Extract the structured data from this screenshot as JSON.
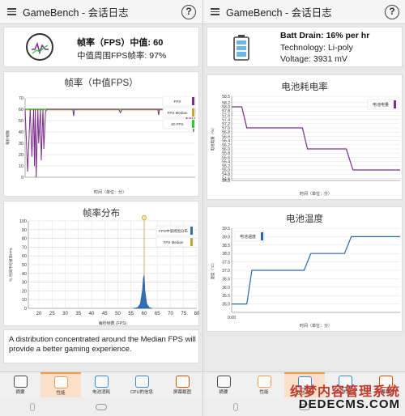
{
  "app": {
    "title": "GameBench - 会话日志",
    "help": "?"
  },
  "left": {
    "summary": {
      "main": "帧率（FPS）中值: 60",
      "sub": "中值周围FPS帧率: 97%"
    },
    "note": "A distribution concentrated around the Median FPS will provide a better gaming experience.",
    "nav": [
      {
        "label": "摘要",
        "icon": "list-icon"
      },
      {
        "label": "性能",
        "icon": "performance-icon"
      },
      {
        "label": "电池消耗",
        "icon": "battery-icon"
      },
      {
        "label": "CPU的信息",
        "icon": "cpu-icon"
      },
      {
        "label": "屏幕截图",
        "icon": "screenshot-icon"
      }
    ]
  },
  "right": {
    "summary": {
      "main": "Batt Drain: 16% per hr",
      "tech": "Technology: Li-poly",
      "voltage": "Voltage: 3931 mV"
    },
    "nav": [
      {
        "label": "摘要",
        "icon": "list-icon"
      },
      {
        "label": "性能",
        "icon": "performance-icon"
      },
      {
        "label": "电池消耗",
        "icon": "battery-icon"
      },
      {
        "label": "CPU的信息",
        "icon": "cpu-icon"
      },
      {
        "label": "屏幕截图",
        "icon": "screenshot-icon"
      }
    ]
  },
  "colors": {
    "fps": "#7a2d8a",
    "median": "#c9a23a",
    "sixty": "#2ecc2e",
    "battery": "#7a2d8a",
    "temp": "#2a67b0",
    "accent": "#f29a4d"
  },
  "watermark": {
    "line1": "织梦内容管理系统",
    "line2": "DEDECMS.COM"
  },
  "chart_data": [
    {
      "type": "line",
      "title": "帧率（中值FPS）",
      "xlabel": "时间（单位：分）",
      "ylabel": "每秒帧数",
      "ylim": [
        0,
        70
      ],
      "yticks": [
        0,
        10,
        20,
        30,
        40,
        50,
        60,
        70
      ],
      "xlim": [
        0,
        1
      ],
      "legend": [
        "FPS",
        "FPS Median",
        "60 FPS"
      ],
      "series": [
        {
          "name": "FPS",
          "points": [
            [
              0,
              60
            ],
            [
              0.015,
              5
            ],
            [
              0.03,
              60
            ],
            [
              0.04,
              18
            ],
            [
              0.05,
              60
            ],
            [
              0.055,
              10
            ],
            [
              0.06,
              60
            ],
            [
              0.065,
              0
            ],
            [
              0.075,
              60
            ],
            [
              0.08,
              30
            ],
            [
              0.09,
              60
            ],
            [
              0.095,
              15
            ],
            [
              0.105,
              60
            ],
            [
              0.11,
              25
            ],
            [
              0.12,
              58
            ],
            [
              0.13,
              60
            ],
            [
              0.28,
              60
            ],
            [
              0.285,
              54
            ],
            [
              0.29,
              60
            ],
            [
              0.55,
              60
            ],
            [
              0.56,
              57
            ],
            [
              0.57,
              60
            ],
            [
              0.78,
              60
            ],
            [
              0.785,
              55
            ],
            [
              0.79,
              60
            ],
            [
              0.94,
              60
            ],
            [
              0.95,
              50
            ],
            [
              0.96,
              60
            ],
            [
              0.97,
              45
            ],
            [
              0.98,
              60
            ],
            [
              0.99,
              40
            ],
            [
              1.0,
              60
            ]
          ]
        },
        {
          "name": "FPS Median",
          "value": 60
        },
        {
          "name": "60 FPS",
          "value": 60
        }
      ]
    },
    {
      "type": "area",
      "title": "帧率分布",
      "xlabel": "每秒帧数 (FPS)",
      "ylabel": "％ 时间平均帧率FPS",
      "ylim": [
        0,
        100
      ],
      "yticks": [
        0,
        10,
        20,
        30,
        40,
        50,
        60,
        70,
        80,
        90,
        100
      ],
      "xlim": [
        16,
        80
      ],
      "xticks": [
        20,
        25,
        30,
        35,
        40,
        45,
        50,
        55,
        60,
        65,
        70,
        75,
        80
      ],
      "legend": [
        "FPS中值周围分布",
        "FPS Median"
      ],
      "median": 60,
      "points": [
        [
          56,
          0
        ],
        [
          57.5,
          1
        ],
        [
          58.5,
          5
        ],
        [
          59.3,
          20
        ],
        [
          59.7,
          35
        ],
        [
          60,
          38
        ],
        [
          60.3,
          20
        ],
        [
          61,
          5
        ],
        [
          62,
          1
        ],
        [
          63,
          0
        ]
      ]
    },
    {
      "type": "line",
      "title": "电池耗电率",
      "xlabel": "时间（单位：分）",
      "ylabel": "电池电量（%）",
      "ylim": [
        54.5,
        58.5
      ],
      "yticks": [
        54.5,
        54.6,
        54.8,
        55.0,
        55.2,
        55.4,
        55.6,
        55.8,
        56.0,
        56.2,
        56.4,
        56.6,
        56.8,
        57.0,
        57.2,
        57.4,
        57.6,
        57.8,
        58.0,
        58.2,
        58.5
      ],
      "legend": [
        "电池电量"
      ],
      "points": [
        [
          0,
          58.0
        ],
        [
          0.06,
          58.0
        ],
        [
          0.09,
          57.0
        ],
        [
          0.42,
          57.0
        ],
        [
          0.45,
          56.0
        ],
        [
          0.68,
          56.0
        ],
        [
          0.72,
          55.0
        ],
        [
          1.0,
          55.0
        ]
      ]
    },
    {
      "type": "line",
      "title": "电池温度",
      "xlabel": "时间（单位：分）",
      "ylabel": "温度（°C）",
      "ylim": [
        34.5,
        39.5
      ],
      "yticks": [
        35.0,
        35.5,
        36.0,
        36.5,
        37.0,
        37.5,
        38.0,
        38.5,
        39.0,
        39.5
      ],
      "xtick": "0:00",
      "legend": [
        "电池温度"
      ],
      "points": [
        [
          0,
          35.0
        ],
        [
          0.09,
          35.0
        ],
        [
          0.12,
          37.0
        ],
        [
          0.43,
          37.0
        ],
        [
          0.47,
          38.0
        ],
        [
          0.67,
          38.0
        ],
        [
          0.71,
          39.0
        ],
        [
          1.0,
          39.0
        ]
      ]
    }
  ]
}
